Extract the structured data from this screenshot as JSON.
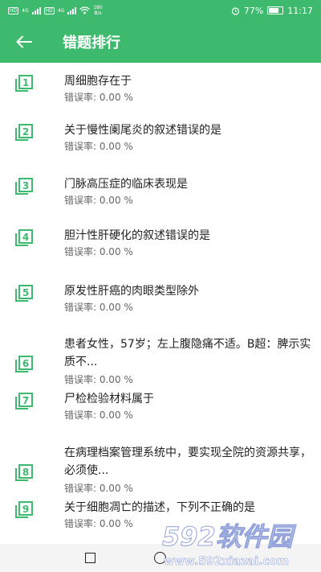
{
  "status_bar": {
    "chip1": "HD",
    "chip2": "HD",
    "speed_value": "180",
    "speed_unit": "B/s",
    "battery": "77%",
    "time": "11:17",
    "net1": "4G",
    "net2": "4G"
  },
  "app_bar": {
    "title": "错题排行",
    "back_icon": "arrow-left-icon"
  },
  "items": [
    {
      "rank": "1",
      "title": "周细胞存在于",
      "rate": "错误率:  0.00 %"
    },
    {
      "rank": "2",
      "title": "关于慢性阑尾炎的叙述错误的是",
      "rate": "错误率:  0.00 %"
    },
    {
      "rank": "3",
      "title": "门脉高压症的临床表现是",
      "rate": "错误率:  0.00 %"
    },
    {
      "rank": "4",
      "title": "胆汁性肝硬化的叙述错误的是",
      "rate": "错误率:  0.00 %"
    },
    {
      "rank": "5",
      "title": "原发性肝癌的肉眼类型除外",
      "rate": "错误率:  0.00 %"
    },
    {
      "rank": "6",
      "title": "患者女性，57岁；左上腹隐痛不适。B超：脾示实质不...",
      "rate": "错误率:  0.00 %"
    },
    {
      "rank": "7",
      "title": "尸检检验材料属于",
      "rate": "错误率:  0.00 %"
    },
    {
      "rank": "8",
      "title": "在病理档案管理系统中，要实现全院的资源共享，必须使...",
      "rate": "错误率:  0.00 %"
    },
    {
      "rank": "9",
      "title": "关于细胞凋亡的描述，下列不正确的是",
      "rate": "错误率:  0.00 %"
    }
  ],
  "watermark": {
    "brand": "592软件园",
    "url": "www.592xiazai.com"
  },
  "colors": {
    "primary": "#3dba6e",
    "icon": "#3dba6e"
  }
}
